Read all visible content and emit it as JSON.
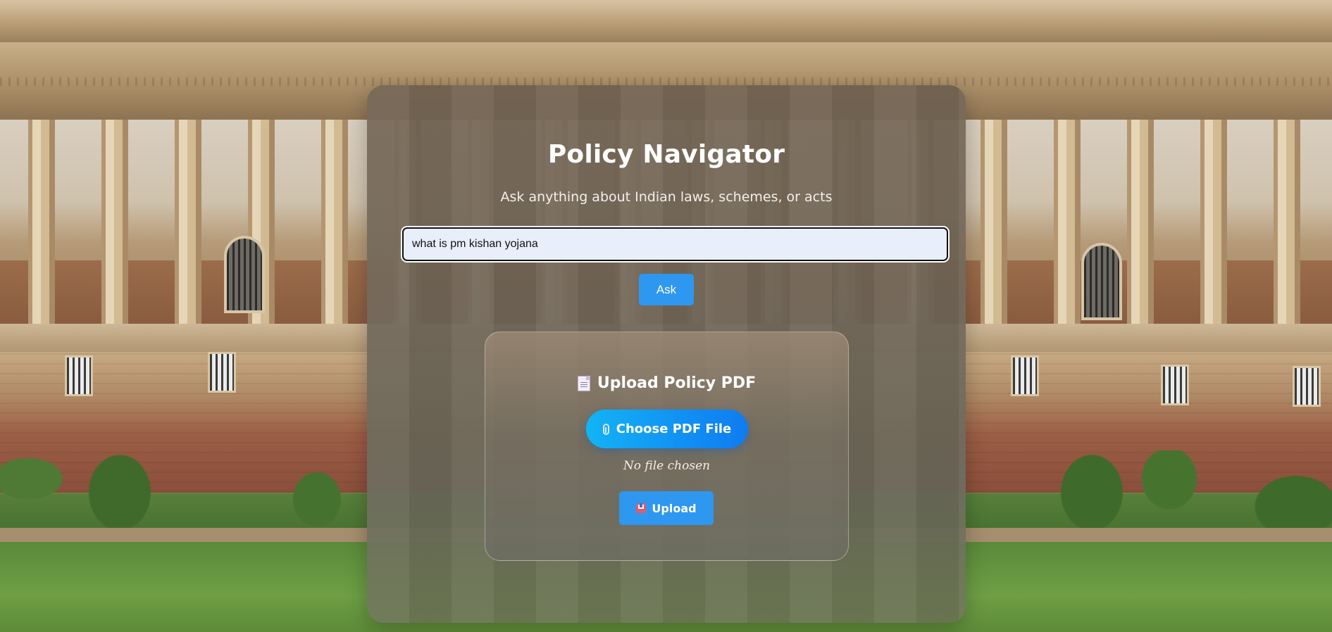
{
  "app": {
    "title": "Policy Navigator",
    "subtitle": "Ask anything about Indian laws, schemes, or acts"
  },
  "search": {
    "value": "what is pm kishan yojana",
    "ask_label": "Ask"
  },
  "upload": {
    "heading": "Upload Policy PDF",
    "heading_icon": "document-icon",
    "choose_label": "Choose PDF File",
    "choose_icon": "paperclip-icon",
    "file_status": "No file chosen",
    "upload_label": "Upload",
    "upload_icon": "inbox-tray-icon"
  },
  "colors": {
    "primary_button": "#2e97f0",
    "choose_gradient_start": "#12b4f5",
    "choose_gradient_end": "#0f7cf0",
    "input_background": "#e8effb"
  }
}
